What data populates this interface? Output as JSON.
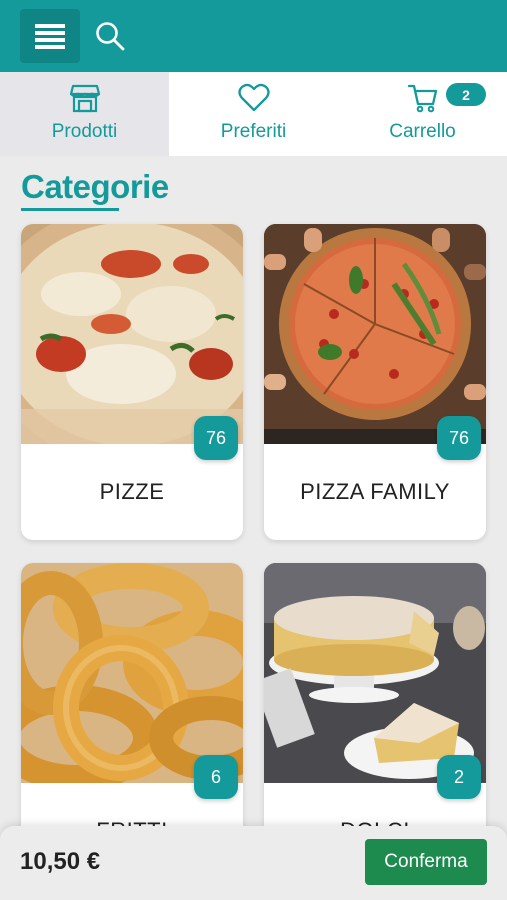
{
  "header": {
    "menu_icon": "hamburger-menu-icon",
    "search_icon": "search-icon"
  },
  "tabs": [
    {
      "label": "Prodotti",
      "icon": "storefront-icon",
      "active": true
    },
    {
      "label": "Preferiti",
      "icon": "heart-icon",
      "active": false
    },
    {
      "label": "Carrello",
      "icon": "cart-icon",
      "active": false,
      "badge": "2"
    }
  ],
  "section": {
    "title": "Categorie"
  },
  "categories": [
    {
      "name": "PIZZE",
      "count": "76",
      "image": "pizza-margherita-photo"
    },
    {
      "name": "PIZZA FAMILY",
      "count": "76",
      "image": "family-pizza-photo"
    },
    {
      "name": "FRITTI",
      "count": "6",
      "image": "onion-rings-photo"
    },
    {
      "name": "DOLCI",
      "count": "2",
      "image": "cake-photo"
    }
  ],
  "footer": {
    "total": "10,50 €",
    "confirm_label": "Conferma"
  },
  "colors": {
    "accent": "#149a9b",
    "confirm": "#1d8a4e"
  }
}
